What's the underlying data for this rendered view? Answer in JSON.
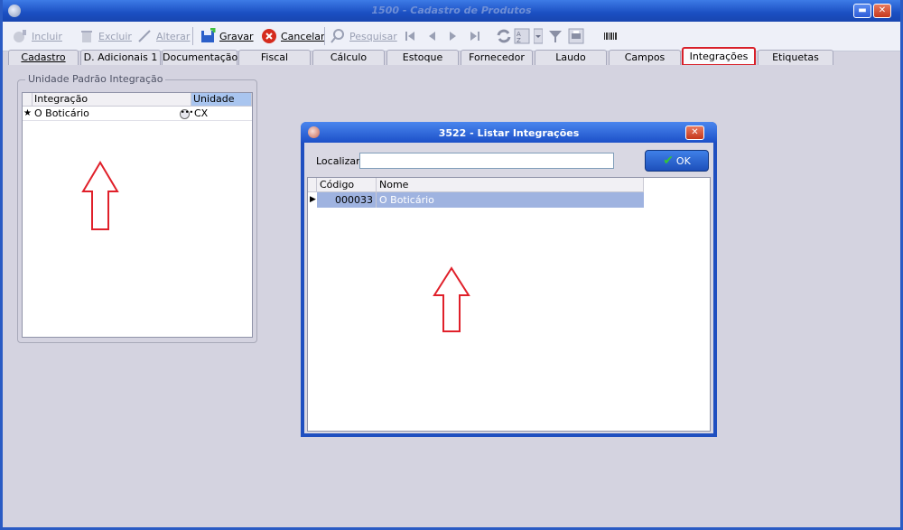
{
  "window": {
    "title": "1500 - Cadastro de Produtos"
  },
  "toolbar": {
    "incluir": "Incluir",
    "excluir": "Excluir",
    "alterar": "Alterar",
    "gravar": "Gravar",
    "cancelar": "Cancelar",
    "pesquisar": "Pesquisar"
  },
  "tabs": [
    "Cadastro",
    "D. Adicionais 1",
    "Documentação",
    "Fiscal",
    "Cálculo Preços",
    "Estoque",
    "Fornecedor",
    "Laudo",
    "Campos Livres",
    "Integrações",
    "Etiquetas"
  ],
  "active_tab": "Integrações",
  "group": {
    "legend": "Unidade Padrão Integração",
    "columns": [
      "Integração",
      "Unidade"
    ],
    "rows": [
      {
        "marker": "★",
        "integracao": "O Boticário",
        "unidade": "CX"
      }
    ]
  },
  "dialog": {
    "title": "3522 - Listar Integrações",
    "search_label": "Localizar",
    "search_value": "",
    "ok_label": "OK",
    "columns": [
      "Código",
      "Nome"
    ],
    "rows": [
      {
        "marker": "▶",
        "codigo": "000033",
        "nome": "O Boticário"
      }
    ]
  },
  "colors": {
    "annotation": "#e0202a",
    "selection": "#9fb3e0",
    "title_bar": "#1f4fc0"
  }
}
